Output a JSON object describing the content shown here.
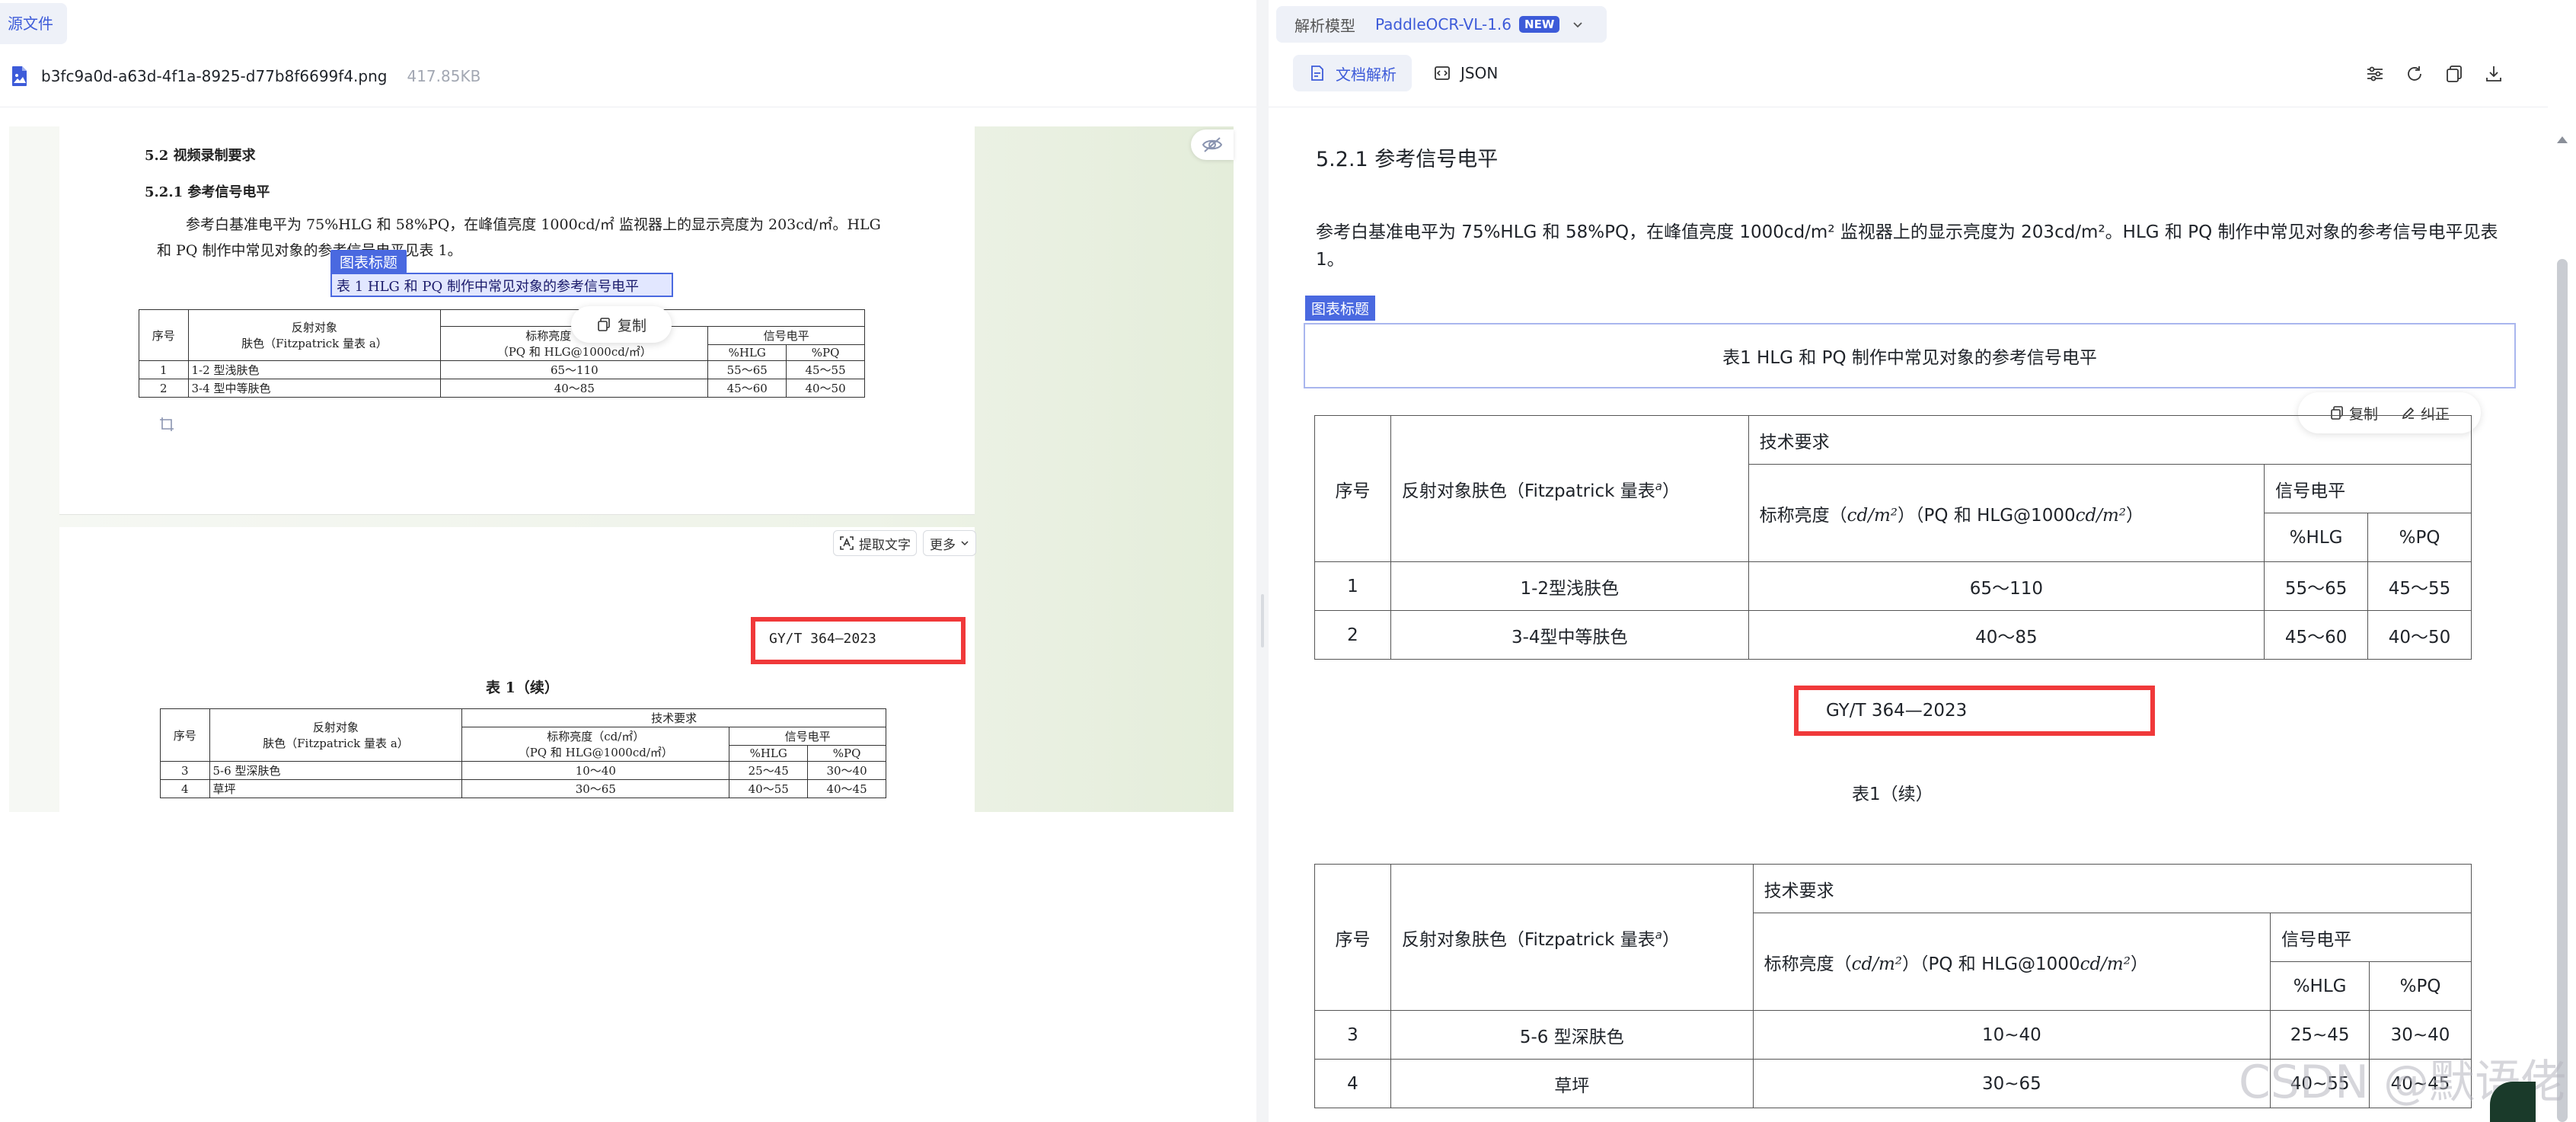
{
  "left": {
    "tab_label": "源文件",
    "file_name": "b3fc9a0d-a63d-4f1a-8925-d77b8f6699f4.png",
    "file_size": "417.85KB",
    "page1": {
      "section": "5.2  视频录制要求",
      "subsection": "5.2.1  参考信号电平",
      "para_line1": "参考白基准电平为 75%HLG 和 58%PQ，在峰值亮度 1000cd/㎡ 监视器上的显示亮度为 203cd/㎡。HLG",
      "para_line2": "和 PQ 制作中常见对象的参考信号电平见表 1。",
      "tag": "图表标题",
      "table_title": "表 1   HLG 和 PQ 制作中常见对象的参考信号电平",
      "copy_label": "复制",
      "table": {
        "col_no": "序号",
        "col_obj_1": "反射对象",
        "col_obj_2": "肤色（Fitzpatrick 量表 a）",
        "col_lum_1": "标称亮度（cd/㎡）",
        "col_lum_2": "（PQ 和 HLG@1000cd/㎡）",
        "col_signal": "信号电平",
        "col_hlg": "%HLG",
        "col_pq": "%PQ",
        "rows": [
          {
            "no": "1",
            "obj": "1-2 型浅肤色",
            "lum": "65～110",
            "hlg": "55～65",
            "pq": "45～55"
          },
          {
            "no": "2",
            "obj": "3-4 型中等肤色",
            "lum": "40～85",
            "hlg": "45～60",
            "pq": "40～50"
          }
        ]
      }
    },
    "page2": {
      "extract_btn": "提取文字",
      "more_btn": "更多",
      "std_no": "GY/T 364—2023",
      "table_cont": "表 1（续）",
      "table": {
        "col_no": "序号",
        "col_obj_1": "反射对象",
        "col_obj_2": "肤色（Fitzpatrick 量表 a）",
        "col_tech": "技术要求",
        "col_lum_1": "标称亮度（cd/㎡）",
        "col_lum_2": "（PQ 和 HLG@1000cd/㎡）",
        "col_signal": "信号电平",
        "col_hlg": "%HLG",
        "col_pq": "%PQ",
        "rows": [
          {
            "no": "3",
            "obj": "5-6 型深肤色",
            "lum": "10～40",
            "hlg": "25～45",
            "pq": "30～40"
          },
          {
            "no": "4",
            "obj": "草坪",
            "lum": "30～65",
            "hlg": "40～55",
            "pq": "40～45"
          }
        ]
      }
    }
  },
  "right": {
    "model_label": "解析模型",
    "model_name": "PaddleOCR-VL-1.6",
    "new_badge": "NEW",
    "tab_doc": "文档解析",
    "tab_json": "JSON",
    "heading": "5.2.1 参考信号电平",
    "para": "参考白基准电平为 75%HLG 和 58%PQ，在峰值亮度 1000cd/m² 监视器上的显示亮度为 203cd/m²。HLG 和 PQ 制作中常见对象的参考信号电平见表 1。",
    "tag": "图表标题",
    "caption": "表1 HLG 和 PQ 制作中常见对象的参考信号电平",
    "copy_label": "复制",
    "correct_label": "纠正",
    "table1": {
      "col_no": "序号",
      "col_obj": "反射对象肤色（Fitzpatrick 量表",
      "col_obj_sup": "a",
      "col_obj_end": "）",
      "col_tech": "技术要求",
      "col_lum_pre": "标称亮度（",
      "col_lum_math": "cd/m²",
      "col_lum_mid": "）（PQ 和 HLG@1000",
      "col_lum_end": "）",
      "col_signal": "信号电平",
      "col_hlg": "%HLG",
      "col_pq": "%PQ",
      "rows": [
        {
          "no": "1",
          "obj": "1-2型浅肤色",
          "lum": "65～110",
          "hlg": "55～65",
          "pq": "45～55"
        },
        {
          "no": "2",
          "obj": "3-4型中等肤色",
          "lum": "40～85",
          "hlg": "45～60",
          "pq": "40～50"
        }
      ]
    },
    "std_no": "GY/T 364—2023",
    "cont_caption": "表1（续）",
    "table2": {
      "rows": [
        {
          "no": "3",
          "obj": "5-6 型深肤色",
          "lum": "10~40",
          "hlg": "25~45",
          "pq": "30~40"
        },
        {
          "no": "4",
          "obj": "草坪",
          "lum": "30~65",
          "hlg": "40~55",
          "pq": "40~45"
        }
      ]
    },
    "watermark": "CSDN @默语佬"
  },
  "colors": {
    "accent": "#3d5bd9",
    "tag_blue": "#4a69e0",
    "highlight_red": "#f0393a"
  }
}
